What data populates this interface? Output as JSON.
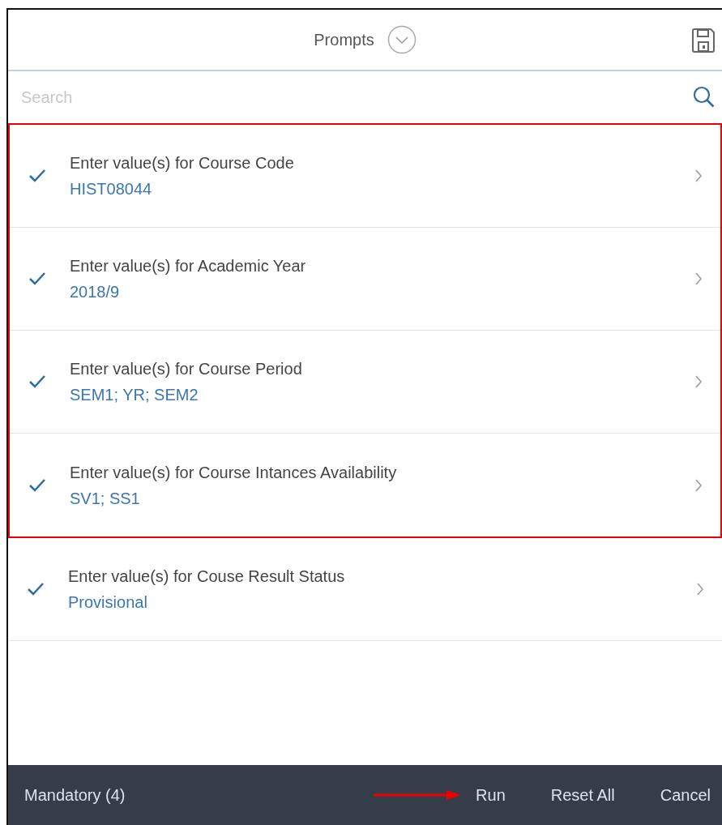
{
  "header": {
    "title": "Prompts"
  },
  "search": {
    "placeholder": "Search"
  },
  "prompts": [
    {
      "label": "Enter value(s) for Course Code",
      "value": "HIST08044",
      "checked": true,
      "highlighted": true
    },
    {
      "label": "Enter value(s) for Academic Year",
      "value": "2018/9",
      "checked": true,
      "highlighted": true
    },
    {
      "label": "Enter value(s) for Course Period",
      "value": "SEM1; YR; SEM2",
      "checked": true,
      "highlighted": true
    },
    {
      "label": "Enter value(s) for Course Intances Availability",
      "value": "SV1; SS1",
      "checked": true,
      "highlighted": true
    },
    {
      "label": "Enter value(s) for Couse Result Status",
      "value": "Provisional",
      "checked": true,
      "highlighted": false
    }
  ],
  "footer": {
    "status": "Mandatory (4)",
    "actions": [
      {
        "label": "Run",
        "arrow": true
      },
      {
        "label": "Reset All",
        "arrow": false
      },
      {
        "label": "Cancel",
        "arrow": false
      }
    ]
  }
}
